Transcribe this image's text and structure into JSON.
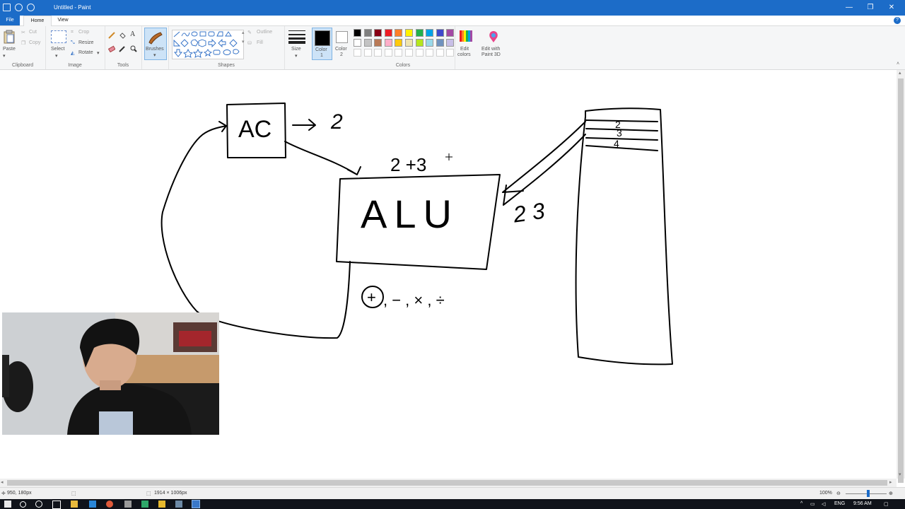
{
  "window": {
    "title": "Untitled - Paint"
  },
  "tabs": {
    "file": "File",
    "home": "Home",
    "view": "View",
    "help": "?"
  },
  "ribbon": {
    "clipboard": {
      "label": "Clipboard",
      "paste": "Paste",
      "cut": "Cut",
      "copy": "Copy"
    },
    "image": {
      "label": "Image",
      "select": "Select",
      "crop": "Crop",
      "resize": "Resize",
      "rotate": "Rotate"
    },
    "tools": {
      "label": "Tools"
    },
    "brushes": {
      "label": "Brushes"
    },
    "shapes": {
      "label": "Shapes",
      "outline": "Outline",
      "fill": "Fill"
    },
    "size": {
      "label": "Size"
    },
    "color1": {
      "label1": "Color",
      "label2": "1"
    },
    "color2": {
      "label1": "Color",
      "label2": "2"
    },
    "colors": {
      "label": "Colors",
      "row1": [
        "#000000",
        "#7f7f7f",
        "#880015",
        "#ed1c24",
        "#ff7f27",
        "#fff200",
        "#22b14c",
        "#00a2e8",
        "#3f48cc",
        "#a349a4"
      ],
      "row2": [
        "#ffffff",
        "#c3c3c3",
        "#b97a57",
        "#ffaec9",
        "#ffc90e",
        "#efe4b0",
        "#b5e61d",
        "#99d9ea",
        "#7092be",
        "#c8bfe7"
      ],
      "row3": [
        "#ffffff",
        "#ffffff",
        "#ffffff",
        "#ffffff",
        "#ffffff",
        "#ffffff",
        "#ffffff",
        "#ffffff",
        "#ffffff",
        "#ffffff"
      ]
    },
    "edit_colors": {
      "line1": "Edit",
      "line2": "colors"
    },
    "paint3d": {
      "line1": "Edit with",
      "line2": "Paint 3D"
    }
  },
  "drawing": {
    "ac": "AC",
    "alu": "ALU",
    "arrow_value": "2",
    "sum": "2 +3",
    "operands": "2 3",
    "memory_values": [
      "2",
      "3",
      "4"
    ],
    "ops": ", − , × , ÷"
  },
  "status": {
    "cursor": "950, 180px",
    "canvas_size": "1914 × 1006px",
    "zoom": "100%"
  },
  "taskbar": {
    "lang": "ENG",
    "time": "9:56 AM"
  }
}
